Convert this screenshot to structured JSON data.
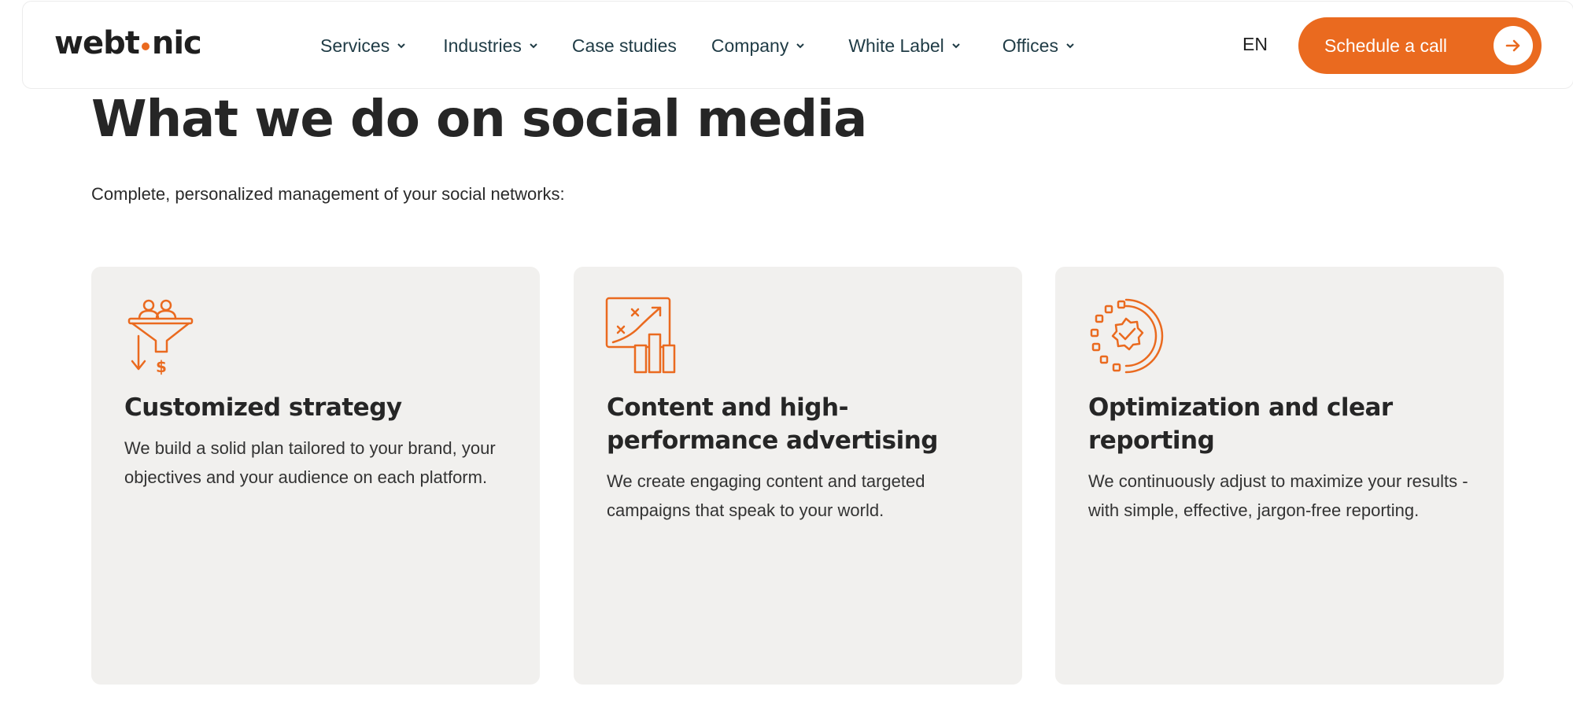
{
  "header": {
    "logo_left": "webt",
    "logo_right": "nic",
    "nav": [
      {
        "label": "Services",
        "has_dropdown": true
      },
      {
        "label": "Industries",
        "has_dropdown": true
      },
      {
        "label": "Case studies",
        "has_dropdown": false
      },
      {
        "label": "Company",
        "has_dropdown": true
      },
      {
        "label": "White Label",
        "has_dropdown": true
      },
      {
        "label": "Offices",
        "has_dropdown": true
      }
    ],
    "language": "EN",
    "cta_label": "Schedule a call"
  },
  "main": {
    "heading": "What we do on social media",
    "subtitle": "Complete, personalized management of your social networks:",
    "cards": [
      {
        "icon": "funnel-icon",
        "title": "Customized strategy",
        "text": "We build a solid plan tailored to your brand, your objectives and your audience on each platform."
      },
      {
        "icon": "chart-strategy-icon",
        "title": "Content and high-performance advertising",
        "text": "We create engaging content and targeted campaigns that speak to your world."
      },
      {
        "icon": "optimization-badge-icon",
        "title": "Optimization and clear reporting",
        "text": "We continuously adjust to maximize your results - with simple, effective, jargon-free reporting."
      }
    ]
  },
  "colors": {
    "accent": "#ea6a1f",
    "card_bg": "#f1f0ee",
    "nav_text": "#1f3b45"
  }
}
